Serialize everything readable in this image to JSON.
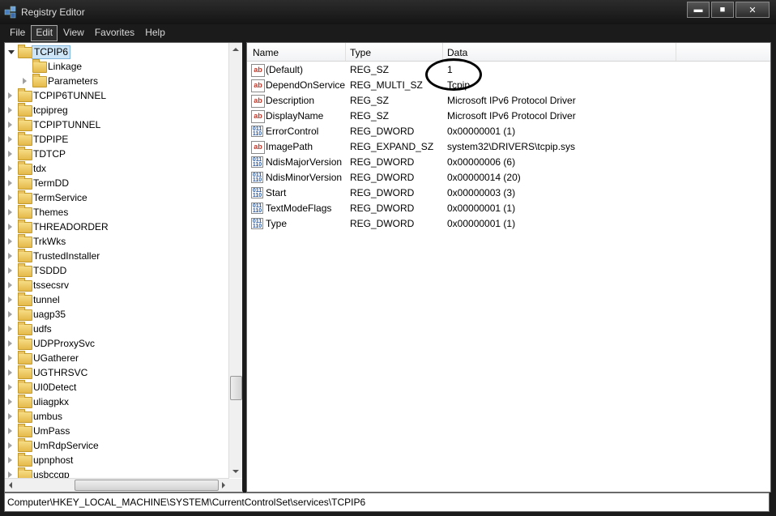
{
  "window": {
    "title": "Registry Editor",
    "controls": {
      "minimize": "▬",
      "maximize": "■",
      "close": "✕"
    }
  },
  "menu": [
    {
      "label": "File"
    },
    {
      "label": "Edit",
      "active": true
    },
    {
      "label": "View"
    },
    {
      "label": "Favorites"
    },
    {
      "label": "Help"
    }
  ],
  "tree": {
    "items": [
      {
        "label": "TCPIP6",
        "level": 0,
        "expanded": true,
        "selected": true
      },
      {
        "label": "Linkage",
        "level": 1,
        "expanded": false,
        "has_children": false
      },
      {
        "label": "Parameters",
        "level": 1,
        "has_children": true
      },
      {
        "label": "TCPIP6TUNNEL",
        "level": 0
      },
      {
        "label": "tcpipreg",
        "level": 0
      },
      {
        "label": "TCPIPTUNNEL",
        "level": 0
      },
      {
        "label": "TDPIPE",
        "level": 0
      },
      {
        "label": "TDTCP",
        "level": 0
      },
      {
        "label": "tdx",
        "level": 0
      },
      {
        "label": "TermDD",
        "level": 0
      },
      {
        "label": "TermService",
        "level": 0
      },
      {
        "label": "Themes",
        "level": 0
      },
      {
        "label": "THREADORDER",
        "level": 0
      },
      {
        "label": "TrkWks",
        "level": 0
      },
      {
        "label": "TrustedInstaller",
        "level": 0
      },
      {
        "label": "TSDDD",
        "level": 0
      },
      {
        "label": "tssecsrv",
        "level": 0
      },
      {
        "label": "tunnel",
        "level": 0
      },
      {
        "label": "uagp35",
        "level": 0
      },
      {
        "label": "udfs",
        "level": 0
      },
      {
        "label": "UDPProxySvc",
        "level": 0
      },
      {
        "label": "UGatherer",
        "level": 0
      },
      {
        "label": "UGTHRSVC",
        "level": 0
      },
      {
        "label": "UI0Detect",
        "level": 0
      },
      {
        "label": "uliagpkx",
        "level": 0
      },
      {
        "label": "umbus",
        "level": 0
      },
      {
        "label": "UmPass",
        "level": 0
      },
      {
        "label": "UmRdpService",
        "level": 0
      },
      {
        "label": "upnphost",
        "level": 0
      },
      {
        "label": "usbccgp",
        "level": 0
      }
    ],
    "hscroll_grip": "|||"
  },
  "values": {
    "columns": {
      "name": "Name",
      "type": "Type",
      "data": "Data"
    },
    "rows": [
      {
        "icon": "string-value-icon",
        "kind": "sz",
        "name": "(Default)",
        "type": "REG_SZ",
        "data": "1"
      },
      {
        "icon": "string-value-icon",
        "kind": "sz",
        "name": "DependOnService",
        "type": "REG_MULTI_SZ",
        "data": "Tcpip"
      },
      {
        "icon": "string-value-icon",
        "kind": "sz",
        "name": "Description",
        "type": "REG_SZ",
        "data": "Microsoft IPv6 Protocol Driver"
      },
      {
        "icon": "string-value-icon",
        "kind": "sz",
        "name": "DisplayName",
        "type": "REG_SZ",
        "data": "Microsoft IPv6 Protocol Driver"
      },
      {
        "icon": "binary-value-icon",
        "kind": "dw",
        "name": "ErrorControl",
        "type": "REG_DWORD",
        "data": "0x00000001 (1)"
      },
      {
        "icon": "string-value-icon",
        "kind": "sz",
        "name": "ImagePath",
        "type": "REG_EXPAND_SZ",
        "data": "system32\\DRIVERS\\tcpip.sys"
      },
      {
        "icon": "binary-value-icon",
        "kind": "dw",
        "name": "NdisMajorVersion",
        "type": "REG_DWORD",
        "data": "0x00000006 (6)"
      },
      {
        "icon": "binary-value-icon",
        "kind": "dw",
        "name": "NdisMinorVersion",
        "type": "REG_DWORD",
        "data": "0x00000014 (20)"
      },
      {
        "icon": "binary-value-icon",
        "kind": "dw",
        "name": "Start",
        "type": "REG_DWORD",
        "data": "0x00000003 (3)"
      },
      {
        "icon": "binary-value-icon",
        "kind": "dw",
        "name": "TextModeFlags",
        "type": "REG_DWORD",
        "data": "0x00000001 (1)"
      },
      {
        "icon": "binary-value-icon",
        "kind": "dw",
        "name": "Type",
        "type": "REG_DWORD",
        "data": "0x00000001 (1)"
      }
    ]
  },
  "statusbar": {
    "path": "Computer\\HKEY_LOCAL_MACHINE\\SYSTEM\\CurrentControlSet\\services\\TCPIP6"
  },
  "icon_glyphs": {
    "sz": "ab",
    "dw": "011\n110"
  }
}
